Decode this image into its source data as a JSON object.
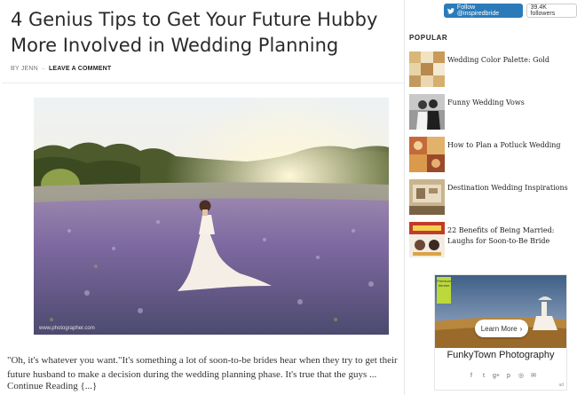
{
  "article": {
    "title": "4 Genius Tips to Get Your Future Hubby More Involved in Wedding Planning",
    "by_label": "BY JENN",
    "comment_link": "LEAVE A COMMENT",
    "photo_credit": "www.photographer.com",
    "excerpt": "\"Oh, it's whatever you want.\"It's something a lot of soon-to-be brides hear when they try to get their future husband to make a decision during the wedding planning phase. It's true that the guys ...",
    "continue_label": "Continue Reading {...}"
  },
  "sidebar": {
    "follow_label": "Follow @inspiredbride",
    "follower_count": "39.4K followers",
    "popular_heading": "POPULAR",
    "popular": [
      {
        "label": "Wedding Color Palette: Gold",
        "icon": "gold-palette-thumbnail"
      },
      {
        "label": "Funny Wedding Vows",
        "icon": "couple-thumbnail"
      },
      {
        "label": "How to Plan a Potluck Wedding",
        "icon": "food-thumbnail"
      },
      {
        "label": "Destination Wedding Inspirations",
        "icon": "destination-thumbnail"
      },
      {
        "label": "22 Benefits of Being Married: Laughs for Soon-to-Be Bride",
        "icon": "benefits-thumbnail"
      }
    ],
    "ad": {
      "tag_text": "Premium Vendor",
      "button_label": "Learn More",
      "vendor_name": "FunkyTown Photography",
      "ad_mark": "ad",
      "social_icons": [
        "facebook-icon",
        "twitter-icon",
        "googleplus-icon",
        "pinterest-icon",
        "instagram-icon",
        "email-icon"
      ],
      "social_glyphs": [
        "f",
        "t",
        "g+",
        "p",
        "◎",
        "✉"
      ]
    }
  },
  "colors": {
    "twitter_blue": "#2b7bb9",
    "ad_tag_green": "#bcd83a"
  }
}
